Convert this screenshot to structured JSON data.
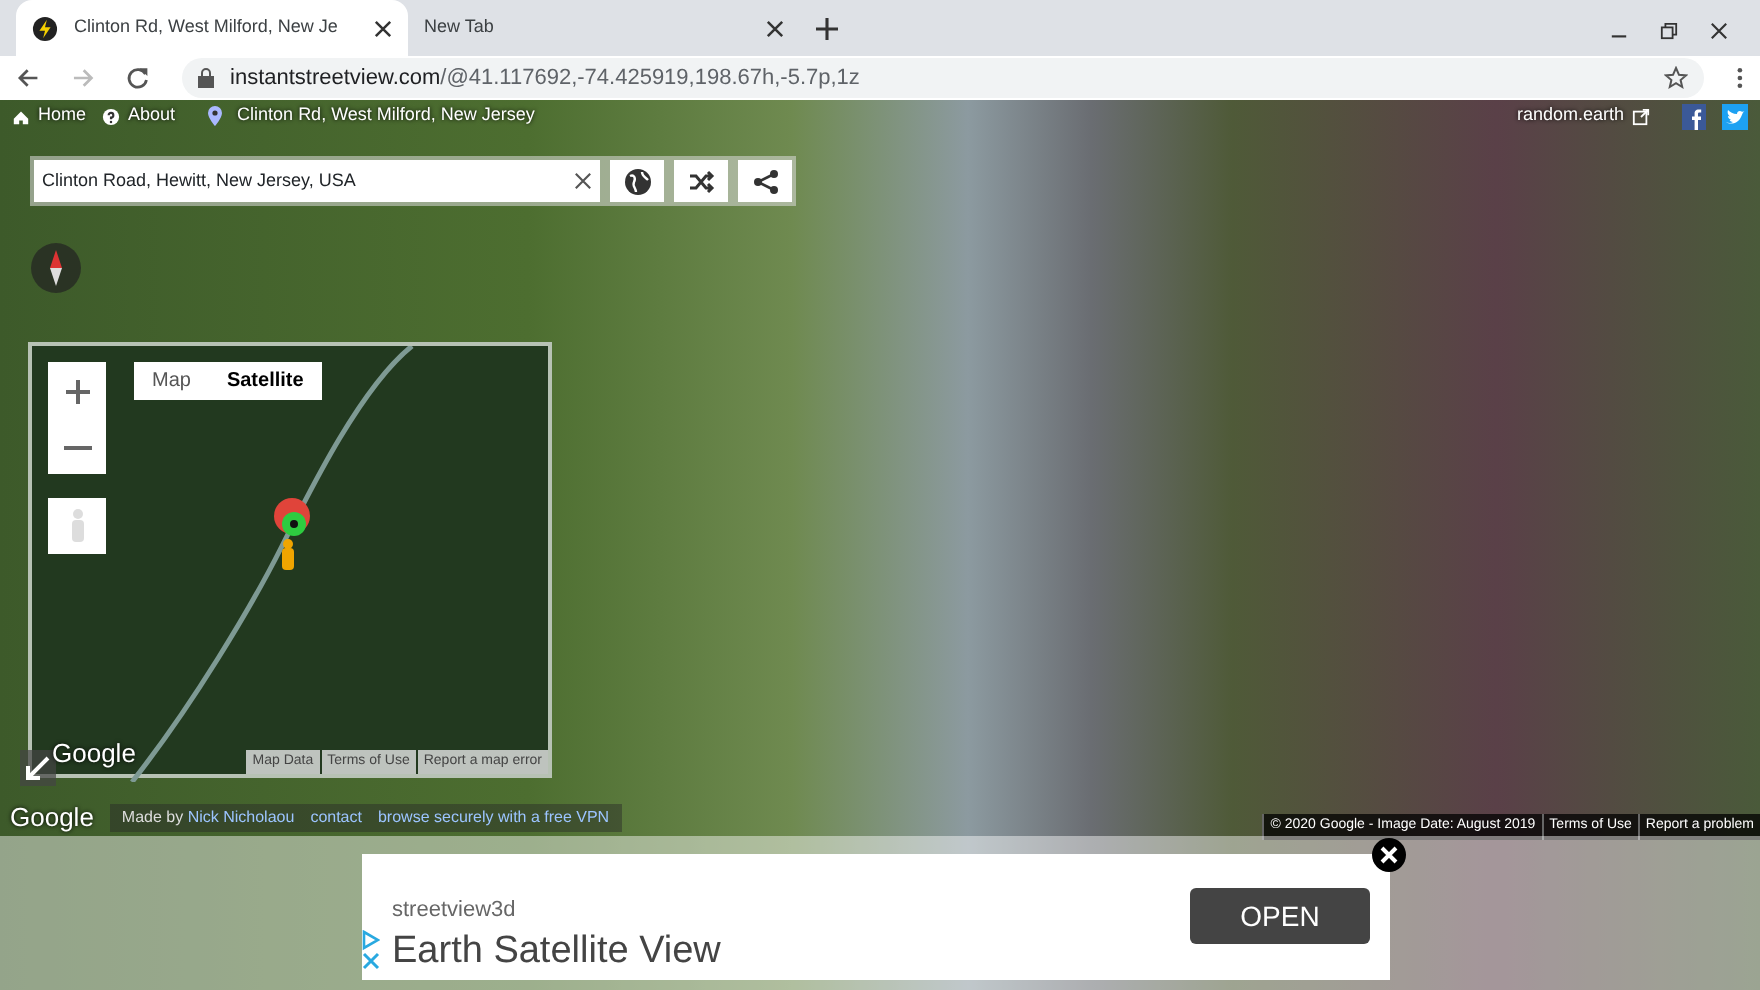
{
  "browser": {
    "tabs": [
      {
        "title": "Clinton Rd, West Milford, New Je",
        "selected": true
      },
      {
        "title": "New Tab",
        "selected": false
      }
    ],
    "url_host": "instantstreetview.com",
    "url_path": "/@41.117692,-74.425919,198.67h,-5.7p,1z"
  },
  "top_nav": {
    "links": [
      "Home",
      "About"
    ],
    "location": "Clinton Rd, West Milford, New Jersey",
    "random_link": "random.earth"
  },
  "search": {
    "value": "Clinton Road, Hewitt, New Jersey, USA"
  },
  "minimap": {
    "map_types": [
      {
        "label": "Map",
        "selected": false
      },
      {
        "label": "Satellite",
        "selected": true
      }
    ],
    "logo": "Google",
    "footer_links": [
      "Map Data",
      "Terms of Use",
      "Report a map error"
    ]
  },
  "footer": {
    "logo": "Google",
    "credit_prefix": "Made by",
    "credit_name": "Nick Nicholaou",
    "links": [
      "contact",
      "browse securely with a free VPN"
    ]
  },
  "attribution": [
    "© 2020 Google - Image Date: August 2019",
    "Terms of Use",
    "Report a problem"
  ],
  "ad": {
    "advertiser": "streetview3d",
    "headline": "Earth Satellite View",
    "button": "OPEN"
  }
}
